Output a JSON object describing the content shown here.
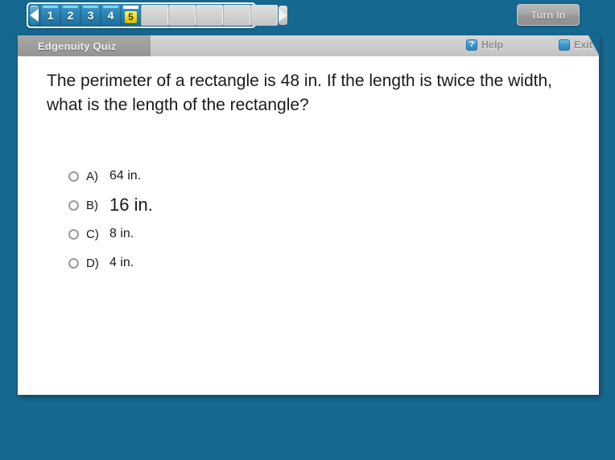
{
  "nav": {
    "prev_label": "◀",
    "next_label": "▶",
    "pages": [
      "1",
      "2",
      "3",
      "4",
      "5"
    ],
    "current_page": "5",
    "empty_slot_count": 5,
    "turn_in_label": "Turn In"
  },
  "panel": {
    "tab_title": "Edgenuity Quiz",
    "help_label": "Help",
    "help_icon_glyph": "?",
    "exit_label": "Exit"
  },
  "question": {
    "text": "The perimeter of a rectangle is 48 in. If the length is twice the width, what is the length of the rectangle?"
  },
  "options": [
    {
      "letter": "A)",
      "text": "64 in.",
      "selected": false,
      "emphasis": false
    },
    {
      "letter": "B)",
      "text": "16 in.",
      "selected": false,
      "emphasis": true
    },
    {
      "letter": "C)",
      "text": "8 in.",
      "selected": false,
      "emphasis": false
    },
    {
      "letter": "D)",
      "text": "4 in.",
      "selected": false,
      "emphasis": false
    }
  ],
  "colors": {
    "background_blue": "#15688f",
    "tab_blue": "#2a82b2",
    "current_page_yellow": "#e8d618",
    "panel_white": "#ffffff",
    "header_gray": "#cccccc",
    "accent_icon_blue": "#3e9ad0"
  }
}
